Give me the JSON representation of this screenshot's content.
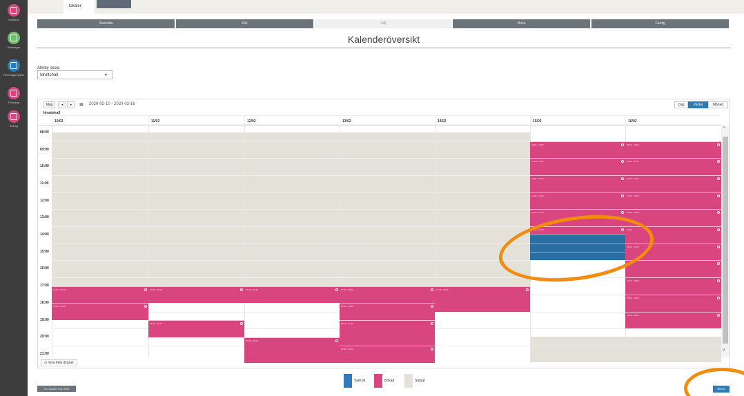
{
  "sidebar": {
    "items": [
      {
        "label": "Utrifkeks",
        "color": "#d9457e",
        "icon": "calendar-icon"
      },
      {
        "label": "Bokningar",
        "color": "#6bbf6a",
        "icon": "check-icon"
      },
      {
        "label": "Föreningsregister",
        "color": "#2e7bb8",
        "icon": "list-icon"
      },
      {
        "label": "Förening",
        "color": "#d9457e",
        "icon": "people-icon"
      },
      {
        "label": "Ärdrag",
        "color": "#d9457e",
        "icon": "document-icon"
      }
    ]
  },
  "top_tabs": {
    "active": "lokaler",
    "inactive": ""
  },
  "steps": [
    "Startsida",
    "Sök",
    "Välj",
    "Boka",
    "Färdig"
  ],
  "page_title": "Kalenderöversikt",
  "school_label": "Almby skola",
  "facility": {
    "selected": "Idrottshall"
  },
  "toolbar": {
    "today": "Idag",
    "prev": "◂",
    "next": "▸",
    "date_range": "2020-02-10 - 2020-02-16",
    "calendar_icon": "calendar-icon"
  },
  "views": {
    "day": "Dag",
    "week": "Vecka",
    "month": "Månad",
    "active": "week"
  },
  "resource_name": "Idrottshall",
  "days": [
    "10/02",
    "11/02",
    "12/02",
    "13/02",
    "14/02",
    "15/02",
    "16/02"
  ],
  "hours": [
    "08:00",
    "09:00",
    "10:00",
    "11:00",
    "12:00",
    "13:00",
    "14:00",
    "15:00",
    "16:00",
    "17:00",
    "18:00",
    "19:00",
    "20:00",
    "21:00"
  ],
  "events_booked": [
    {
      "day": 0,
      "start": 17.5,
      "end": 18.5,
      "label": "17:30 - 18:30"
    },
    {
      "day": 0,
      "start": 18.5,
      "end": 19.5,
      "label": "18:30 - 19:30"
    },
    {
      "day": 1,
      "start": 17.5,
      "end": 18.5,
      "label": "17:30 - 18:30"
    },
    {
      "day": 1,
      "start": 19.5,
      "end": 20.5,
      "label": "19:30 - 20:30"
    },
    {
      "day": 2,
      "start": 17.5,
      "end": 18.5,
      "label": "17:30 - 18:30"
    },
    {
      "day": 2,
      "start": 20.5,
      "end": 22.0,
      "label": "20:30 - 22:00"
    },
    {
      "day": 3,
      "start": 17.5,
      "end": 18.5,
      "label": "17:30 - 18:30"
    },
    {
      "day": 3,
      "start": 18.5,
      "end": 19.5,
      "label": "18:30 - 19:30"
    },
    {
      "day": 3,
      "start": 19.5,
      "end": 21.0,
      "label": "19:30 - 21:00"
    },
    {
      "day": 3,
      "start": 21.0,
      "end": 22.0,
      "label": "21:00 - 22:00"
    },
    {
      "day": 4,
      "start": 17.5,
      "end": 19.0,
      "label": "17:30 - 19:00"
    },
    {
      "day": 5,
      "start": 9.0,
      "end": 10.0,
      "label": "09:00 - 10:00"
    },
    {
      "day": 5,
      "start": 10.0,
      "end": 11.0,
      "label": "10:00 - 11:00"
    },
    {
      "day": 5,
      "start": 11.0,
      "end": 12.0,
      "label": "11:00 - 12:00"
    },
    {
      "day": 5,
      "start": 12.0,
      "end": 13.0,
      "label": "12:00 - 13:00"
    },
    {
      "day": 5,
      "start": 13.0,
      "end": 14.0,
      "label": "13:00 - 14:00"
    },
    {
      "day": 5,
      "start": 14.0,
      "end": 14.5,
      "label": "14:00 - 14:30"
    },
    {
      "day": 6,
      "start": 9.0,
      "end": 10.0,
      "label": "09:00 - 10:00"
    },
    {
      "day": 6,
      "start": 10.0,
      "end": 11.0,
      "label": "10:00 - 11:00"
    },
    {
      "day": 6,
      "start": 11.0,
      "end": 12.0,
      "label": "11:00 - 12:00"
    },
    {
      "day": 6,
      "start": 12.0,
      "end": 13.0,
      "label": "12:00 - 13:00"
    },
    {
      "day": 6,
      "start": 13.0,
      "end": 14.0,
      "label": "13:00 - 14:00"
    },
    {
      "day": 6,
      "start": 14.0,
      "end": 15.0,
      "label": "14:00"
    },
    {
      "day": 6,
      "start": 15.0,
      "end": 16.0,
      "label": "15:00 - 16:00"
    },
    {
      "day": 6,
      "start": 16.0,
      "end": 17.0,
      "label": "16:00"
    },
    {
      "day": 6,
      "start": 17.0,
      "end": 18.0,
      "label": "17:00 - 18:00"
    },
    {
      "day": 6,
      "start": 18.0,
      "end": 19.0,
      "label": "18:00 - 19:00"
    },
    {
      "day": 6,
      "start": 19.0,
      "end": 20.0,
      "label": "19:00 - 20:00"
    }
  ],
  "events_selected": [
    {
      "day": 5,
      "start": 14.5,
      "end": 15.0
    },
    {
      "day": 5,
      "start": 15.0,
      "end": 15.5
    },
    {
      "day": 5,
      "start": 15.5,
      "end": 16.0
    }
  ],
  "closed": [
    {
      "day_from": 0,
      "day_to": 4,
      "start": 8.0,
      "end": 17.5
    },
    {
      "day_from": 5,
      "day_to": 6,
      "start": 20.0,
      "end": 21.5
    }
  ],
  "show_all_label": "Visa hela dygnet",
  "legend": [
    {
      "label": "Vald tid",
      "color": "#2e7bb8"
    },
    {
      "label": "Bokad",
      "color": "#d9457e"
    },
    {
      "label": "Stängt",
      "color": "#e3e1d8"
    }
  ],
  "back_label": "TILLBAKA TILL SÖK",
  "book_label": "BOKA",
  "accent_color": "#f28c0c"
}
